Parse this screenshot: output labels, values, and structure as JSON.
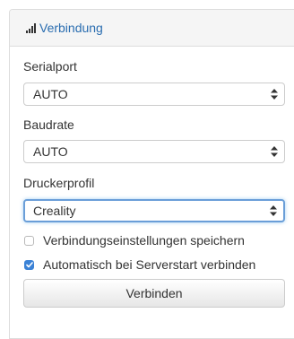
{
  "panel": {
    "title": "Verbindung",
    "icon": "signal-icon"
  },
  "fields": {
    "serialport": {
      "label": "Serialport",
      "value": "AUTO"
    },
    "baudrate": {
      "label": "Baudrate",
      "value": "AUTO"
    },
    "profile": {
      "label": "Druckerprofil",
      "value": "Creality"
    }
  },
  "options": {
    "save_settings": {
      "label": "Verbindungseinstellungen speichern",
      "checked": false
    },
    "autoconnect": {
      "label": "Automatisch bei Serverstart verbinden",
      "checked": true
    }
  },
  "connect_button": "Verbinden",
  "colors": {
    "accent": "#2a6db0",
    "checkbox_checked": "#3b82d6",
    "focus_border": "#6a9ed8"
  }
}
